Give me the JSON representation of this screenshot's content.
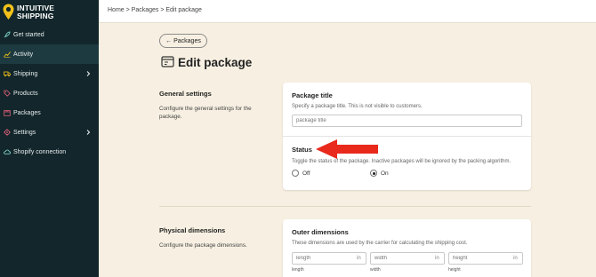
{
  "brand": {
    "line1": "INTUITIVE",
    "line2": "SHIPPING"
  },
  "sidebar": {
    "items": [
      {
        "label": "Get started",
        "icon": "rocket-icon"
      },
      {
        "label": "Activity",
        "icon": "activity-icon",
        "active": true
      },
      {
        "label": "Shipping",
        "icon": "truck-icon",
        "chevron": true
      },
      {
        "label": "Products",
        "icon": "tag-icon"
      },
      {
        "label": "Packages",
        "icon": "package-icon"
      },
      {
        "label": "Settings",
        "icon": "gear-icon",
        "chevron": true
      },
      {
        "label": "Shopify connection",
        "icon": "cloud-icon"
      }
    ]
  },
  "breadcrumb": "Home > Packages > Edit package",
  "back_button": "← Packages",
  "page_title": "Edit package",
  "general": {
    "title": "General settings",
    "desc_line1": "Configure the general settings for the",
    "desc_line2": "package.",
    "package_title": {
      "label": "Package title",
      "help": "Specify a package title. This is not visible to customers.",
      "placeholder": "package title"
    },
    "status": {
      "label": "Status",
      "help": "Toggle the status of the package. Inactive packages will be ignored by the packing algorithm.",
      "options": [
        "Off",
        "On"
      ],
      "selected": "On"
    }
  },
  "physical": {
    "title": "Physical dimensions",
    "desc": "Configure the package dimensions.",
    "outer": {
      "label": "Outer dimensions",
      "help": "These dimensions are used by the carrier for calculating the shipping cost.",
      "fields": [
        {
          "placeholder": "length",
          "suffix": "in",
          "label": "length"
        },
        {
          "placeholder": "width",
          "suffix": "in",
          "label": "width"
        },
        {
          "placeholder": "height",
          "suffix": "in",
          "label": "height"
        }
      ]
    }
  },
  "colors": {
    "sidebar": "#12262b",
    "background": "#f7f0e2",
    "arrow": "#e8291c",
    "logo_pin": "#f2c21a"
  }
}
